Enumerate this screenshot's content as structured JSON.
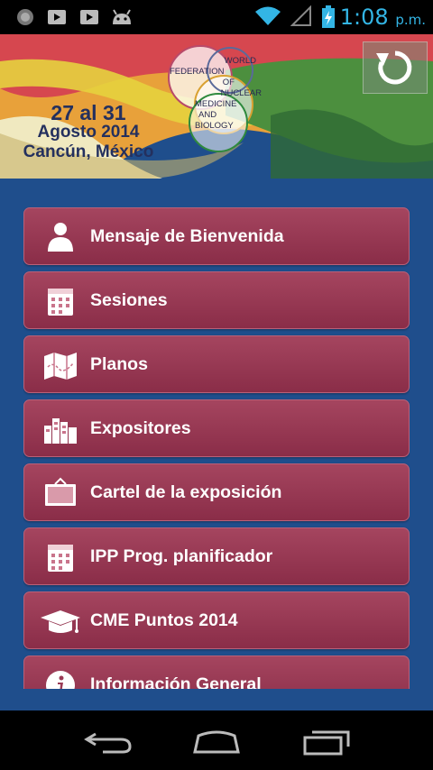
{
  "status_bar": {
    "time": "1:08",
    "ampm": "p.m.",
    "icons": [
      "globe-icon",
      "video-icon",
      "video-icon",
      "android-icon",
      "wifi-icon",
      "signal-icon",
      "battery-charging-icon"
    ]
  },
  "banner": {
    "dates": "27 al 31",
    "month": "Agosto 2014",
    "city": "Cancún, México",
    "logo_lines": [
      "WORLD",
      "FEDERATION",
      "OF",
      "NUCLEAR",
      "MEDICINE",
      "AND",
      "BIOLOGY"
    ],
    "refresh_icon": "refresh-icon"
  },
  "menu": {
    "items": [
      {
        "label": "Mensaje de Bienvenida",
        "icon": "person-icon"
      },
      {
        "label": "Sesiones",
        "icon": "calendar-icon"
      },
      {
        "label": "Planos",
        "icon": "map-icon"
      },
      {
        "label": "Expositores",
        "icon": "buildings-icon"
      },
      {
        "label": "Cartel de la exposición",
        "icon": "poster-icon"
      },
      {
        "label": "IPP Prog. planificador",
        "icon": "calendar-icon"
      },
      {
        "label": "CME Puntos 2014",
        "icon": "graduation-cap-icon"
      },
      {
        "label": "Información General",
        "icon": "info-icon"
      }
    ]
  },
  "nav_bar": {
    "buttons": [
      "back-icon",
      "home-icon",
      "recent-apps-icon"
    ]
  },
  "colors": {
    "background": "#1f4e8c",
    "menu_item": "#9a3a55",
    "status_accent": "#33b5e5"
  }
}
